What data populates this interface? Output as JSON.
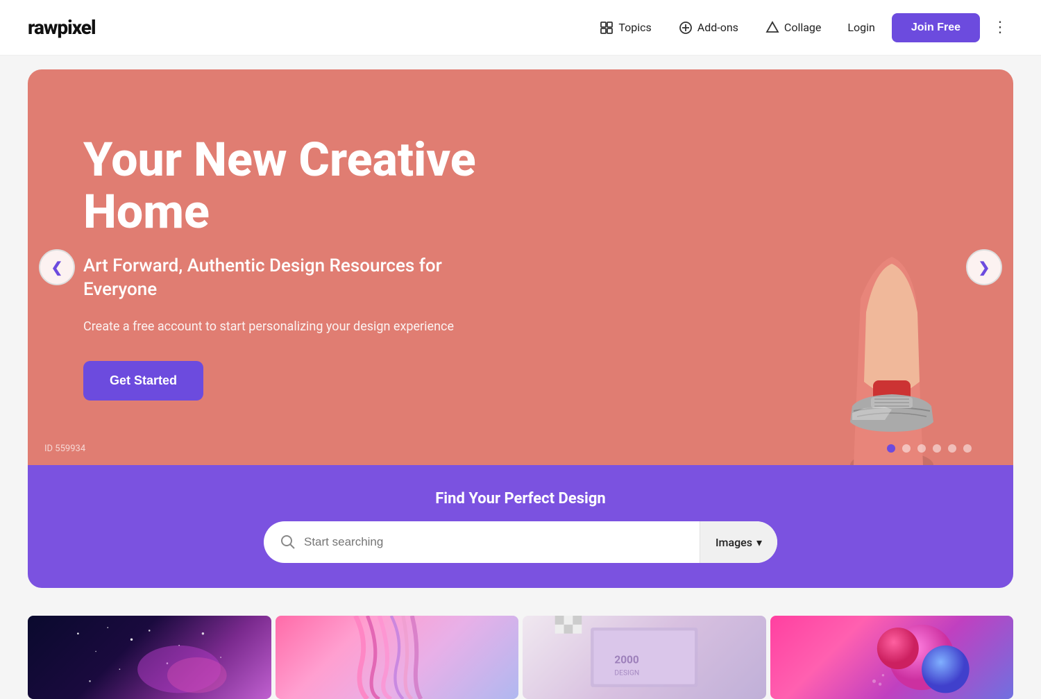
{
  "header": {
    "logo": "rawpixel",
    "nav": {
      "topics_label": "Topics",
      "addons_label": "Add-ons",
      "collage_label": "Collage",
      "login_label": "Login",
      "join_label": "Join Free"
    }
  },
  "hero": {
    "title": "Your New Creative Home",
    "subtitle": "Art Forward, Authentic Design Resources for Everyone",
    "description": "Create a free account to start personalizing your design experience",
    "cta_label": "Get Started",
    "id_label": "ID 559934",
    "dots": [
      {
        "active": true
      },
      {
        "active": false
      },
      {
        "active": false
      },
      {
        "active": false
      },
      {
        "active": false
      },
      {
        "active": false
      }
    ]
  },
  "search": {
    "title": "Find Your Perfect Design",
    "placeholder": "Start searching",
    "dropdown_label": "Images",
    "dropdown_arrow": "▾"
  },
  "arrows": {
    "left": "❮",
    "right": "❯"
  }
}
